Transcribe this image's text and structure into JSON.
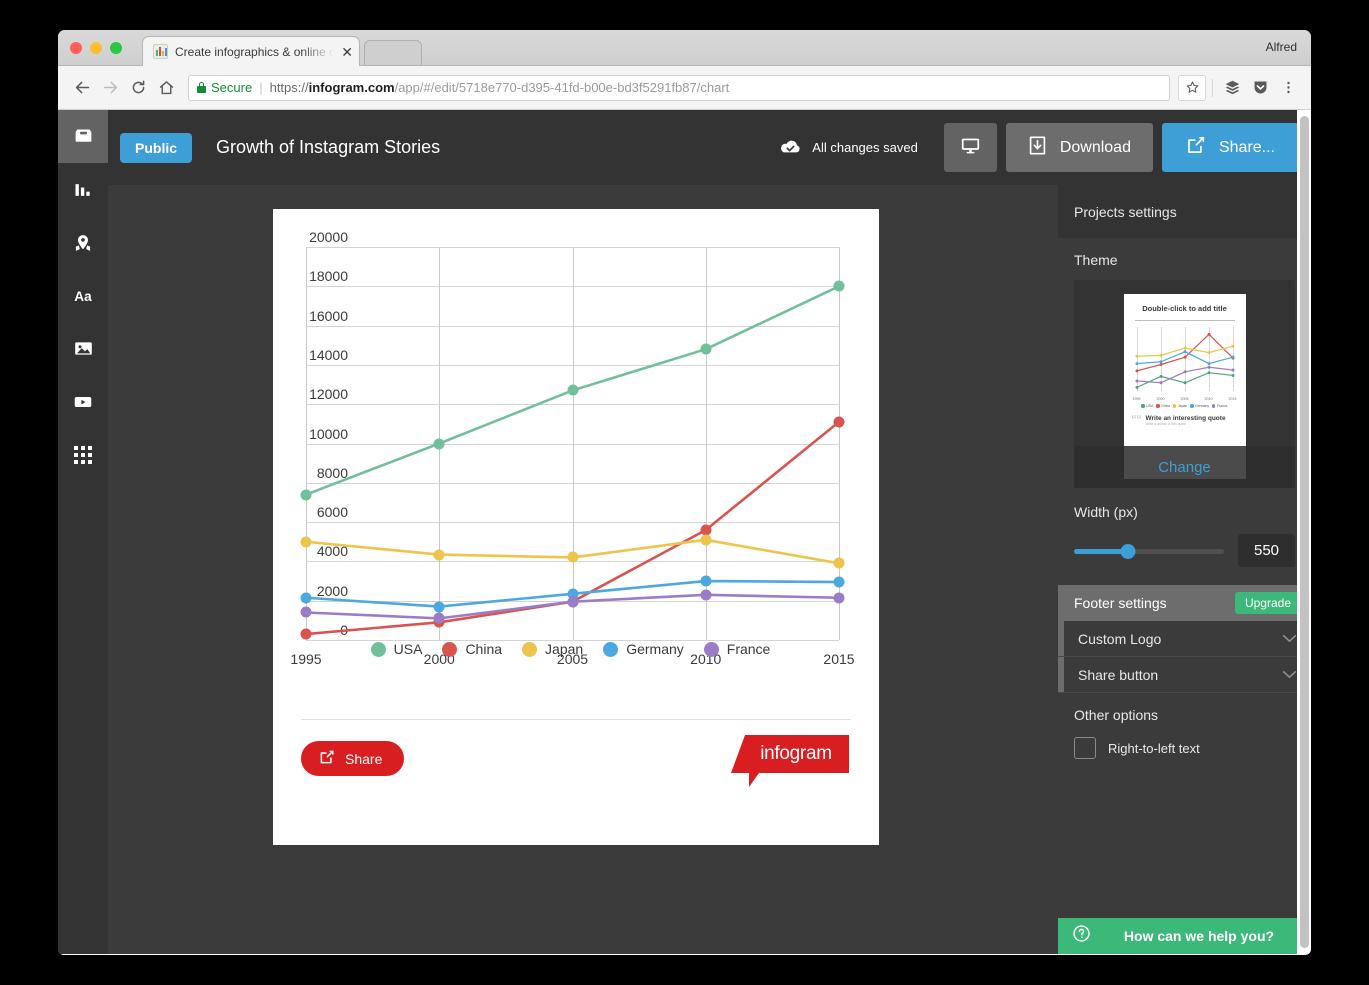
{
  "window": {
    "user_label": "Alfred",
    "tab_title": "Create infographics & online ch",
    "tab_close": "✕",
    "favicon_name": "infogram-favicon"
  },
  "browser": {
    "secure_label": "Secure",
    "url_scheme": "https://",
    "url_host": "infogram.com",
    "url_path": "/app/#/edit/5718e770-d395-41fd-b00e-bd3f5291fb87/chart",
    "back_icon": "back-arrow-icon",
    "forward_icon": "forward-arrow-icon",
    "reload_icon": "reload-icon",
    "home_icon": "home-icon",
    "star_icon": "bookmark-star-icon",
    "layers_icon": "layers-extension-icon",
    "pocket_icon": "pocket-extension-icon",
    "menu_icon": "three-dot-menu-icon"
  },
  "rail": {
    "items": [
      {
        "icon": "inbox-tray-icon",
        "name": "sidebar-item-library",
        "active": true
      },
      {
        "icon": "bar-chart-icon",
        "name": "sidebar-item-charts",
        "active": false
      },
      {
        "icon": "map-pin-icon",
        "name": "sidebar-item-maps",
        "active": false
      },
      {
        "icon": "text-aa-icon",
        "name": "sidebar-item-text",
        "active": false
      },
      {
        "icon": "image-icon",
        "name": "sidebar-item-images",
        "active": false
      },
      {
        "icon": "video-play-icon",
        "name": "sidebar-item-video",
        "active": false
      },
      {
        "icon": "grid-dots-icon",
        "name": "sidebar-item-more",
        "active": false
      }
    ]
  },
  "header": {
    "visibility_pill": "Public",
    "title": "Growth of Instagram Stories",
    "save_status": "All changes saved",
    "present_icon": "monitor-present-icon",
    "download_label": "Download",
    "download_icon": "download-icon",
    "share_label": "Share...",
    "share_icon": "share-export-icon"
  },
  "card": {
    "share_button": "Share",
    "share_icon": "share-export-icon",
    "brand": "infogram"
  },
  "chart_data": {
    "type": "line",
    "title": "",
    "xlabel": "",
    "ylabel": "",
    "categories": [
      "1995",
      "2000",
      "2005",
      "2010",
      "2015"
    ],
    "yticks": [
      0,
      2000,
      4000,
      6000,
      8000,
      10000,
      12000,
      14000,
      16000,
      18000,
      20000
    ],
    "ylim": [
      0,
      20000
    ],
    "grid": true,
    "legend_position": "bottom",
    "series": [
      {
        "name": "USA",
        "color": "#72bf9b",
        "values": [
          7400,
          10000,
          12700,
          14800,
          18000
        ]
      },
      {
        "name": "China",
        "color": "#d9534f",
        "values": [
          300,
          900,
          1950,
          5600,
          11100
        ]
      },
      {
        "name": "Japan",
        "color": "#edc44c",
        "values": [
          5000,
          4350,
          4200,
          5100,
          3900
        ]
      },
      {
        "name": "Germany",
        "color": "#4ba9df",
        "values": [
          2150,
          1700,
          2350,
          3000,
          2950
        ]
      },
      {
        "name": "France",
        "color": "#9b7cc6",
        "values": [
          1400,
          1100,
          1950,
          2300,
          2150
        ]
      }
    ]
  },
  "settings": {
    "panel_title": "Projects settings",
    "theme": {
      "label": "Theme",
      "thumb_title": "Double-click to add title",
      "thumb_years": [
        "1995",
        "2000",
        "2005",
        "2010",
        "2015"
      ],
      "thumb_legend": [
        {
          "name": "USA",
          "color": "#4aa876"
        },
        {
          "name": "China",
          "color": "#d9534f"
        },
        {
          "name": "Japan",
          "color": "#edc44c"
        },
        {
          "name": "Germany",
          "color": "#4ba9df"
        },
        {
          "name": "France",
          "color": "#9b7cc6"
        }
      ],
      "quote_title": "Write an interesting quote",
      "quote_sub": "Write a author of this quote",
      "change_label": "Change"
    },
    "width": {
      "label": "Width (px)",
      "value": "550"
    },
    "footer": {
      "label": "Footer settings",
      "upgrade_label": "Upgrade",
      "rows": [
        {
          "label": "Custom Logo",
          "icon": "chevron-down-icon"
        },
        {
          "label": "Share button",
          "icon": "chevron-down-icon"
        }
      ]
    },
    "other": {
      "label": "Other options",
      "checkbox_label": "Right-to-left text",
      "checked": false
    },
    "help": {
      "label": "How can we help you?",
      "icon": "question-circle-icon"
    }
  },
  "colors": {
    "accent_blue": "#3d9fd6",
    "green": "#3cb878",
    "red": "#d81e20"
  }
}
